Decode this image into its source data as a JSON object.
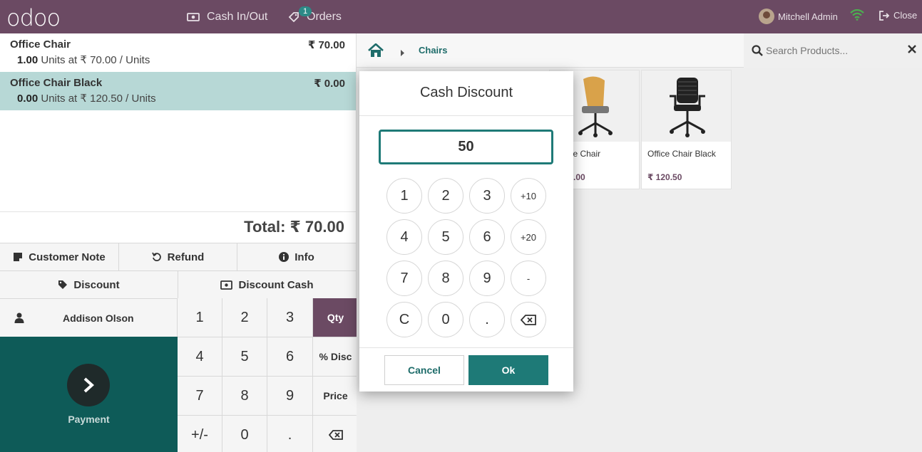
{
  "header": {
    "logo": "odoo",
    "cash_in_out": "Cash In/Out",
    "orders_label": "Orders",
    "orders_count": "1",
    "user_name": "Mitchell Admin",
    "close_label": "Close"
  },
  "order": {
    "lines": [
      {
        "name": "Office Chair",
        "price": "₹ 70.00",
        "qty": "1.00",
        "info": " Units at ₹ 70.00 / Units"
      },
      {
        "name": "Office Chair Black",
        "price": "₹ 0.00",
        "qty": "0.00",
        "info": " Units at ₹ 120.50 / Units"
      }
    ],
    "total": "Total: ₹ 70.00"
  },
  "controls": {
    "customer_note": "Customer Note",
    "refund": "Refund",
    "info": "Info",
    "discount": "Discount",
    "discount_cash": "Discount Cash",
    "customer_name": "Addison Olson",
    "payment": "Payment"
  },
  "numpad": {
    "keys": [
      "1",
      "2",
      "3",
      "Qty",
      "4",
      "5",
      "6",
      "% Disc",
      "7",
      "8",
      "9",
      "Price",
      "+/-",
      "0",
      "."
    ],
    "active_mode": "Qty"
  },
  "products": {
    "breadcrumb": "Chairs",
    "search_placeholder": "Search Products...",
    "items": [
      {
        "name": "Office Chair",
        "price": "₹ 70.00"
      },
      {
        "name": "Office Chair Black",
        "price": "₹ 120.50"
      }
    ]
  },
  "dialog": {
    "title": "Cash Discount",
    "value": "50",
    "keys": [
      "1",
      "2",
      "3",
      "+10",
      "4",
      "5",
      "6",
      "+20",
      "7",
      "8",
      "9",
      "-",
      "C",
      "0",
      "."
    ],
    "cancel": "Cancel",
    "ok": "Ok"
  },
  "colors": {
    "header": "#6b4a63",
    "accent": "#1e7a77",
    "selected_line": "#b7d8d6",
    "payment_bg": "#0e5b58"
  }
}
